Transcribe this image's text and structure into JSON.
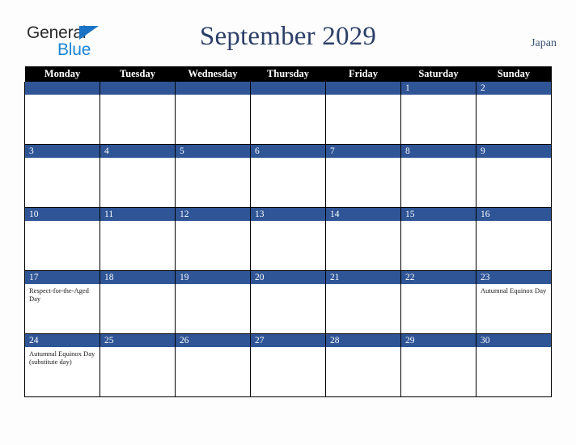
{
  "brand": {
    "name_part1": "General",
    "name_part2": "Blue",
    "triangle_icon": "triangle-icon",
    "colors": {
      "general_text": "#2b2b2b",
      "blue_text": "#1a85d6",
      "triangle": "#1a73c4"
    }
  },
  "header": {
    "title": "September 2029",
    "country": "Japan",
    "title_color": "#2b3f68"
  },
  "calendar": {
    "weekday_headers": [
      "Monday",
      "Tuesday",
      "Wednesday",
      "Thursday",
      "Friday",
      "Saturday",
      "Sunday"
    ],
    "header_bg": "#000000",
    "header_text_color": "#ffffff",
    "date_bar_bg": "#2f5596",
    "date_bar_text_color": "#ffffff",
    "cell_bg": "#ffffff",
    "border_color": "#000000",
    "weeks": [
      {
        "days": [
          {
            "date": "",
            "events": []
          },
          {
            "date": "",
            "events": []
          },
          {
            "date": "",
            "events": []
          },
          {
            "date": "",
            "events": []
          },
          {
            "date": "",
            "events": []
          },
          {
            "date": "1",
            "events": []
          },
          {
            "date": "2",
            "events": []
          }
        ]
      },
      {
        "days": [
          {
            "date": "3",
            "events": []
          },
          {
            "date": "4",
            "events": []
          },
          {
            "date": "5",
            "events": []
          },
          {
            "date": "6",
            "events": []
          },
          {
            "date": "7",
            "events": []
          },
          {
            "date": "8",
            "events": []
          },
          {
            "date": "9",
            "events": []
          }
        ]
      },
      {
        "days": [
          {
            "date": "10",
            "events": []
          },
          {
            "date": "11",
            "events": []
          },
          {
            "date": "12",
            "events": []
          },
          {
            "date": "13",
            "events": []
          },
          {
            "date": "14",
            "events": []
          },
          {
            "date": "15",
            "events": []
          },
          {
            "date": "16",
            "events": []
          }
        ]
      },
      {
        "days": [
          {
            "date": "17",
            "events": [
              "Respect-for-the-Aged Day"
            ]
          },
          {
            "date": "18",
            "events": []
          },
          {
            "date": "19",
            "events": []
          },
          {
            "date": "20",
            "events": []
          },
          {
            "date": "21",
            "events": []
          },
          {
            "date": "22",
            "events": []
          },
          {
            "date": "23",
            "events": [
              "Autumnal Equinox Day"
            ]
          }
        ]
      },
      {
        "days": [
          {
            "date": "24",
            "events": [
              "Autumnal Equinox Day (substitute day)"
            ]
          },
          {
            "date": "25",
            "events": []
          },
          {
            "date": "26",
            "events": []
          },
          {
            "date": "27",
            "events": []
          },
          {
            "date": "28",
            "events": []
          },
          {
            "date": "29",
            "events": []
          },
          {
            "date": "30",
            "events": []
          }
        ]
      }
    ]
  }
}
